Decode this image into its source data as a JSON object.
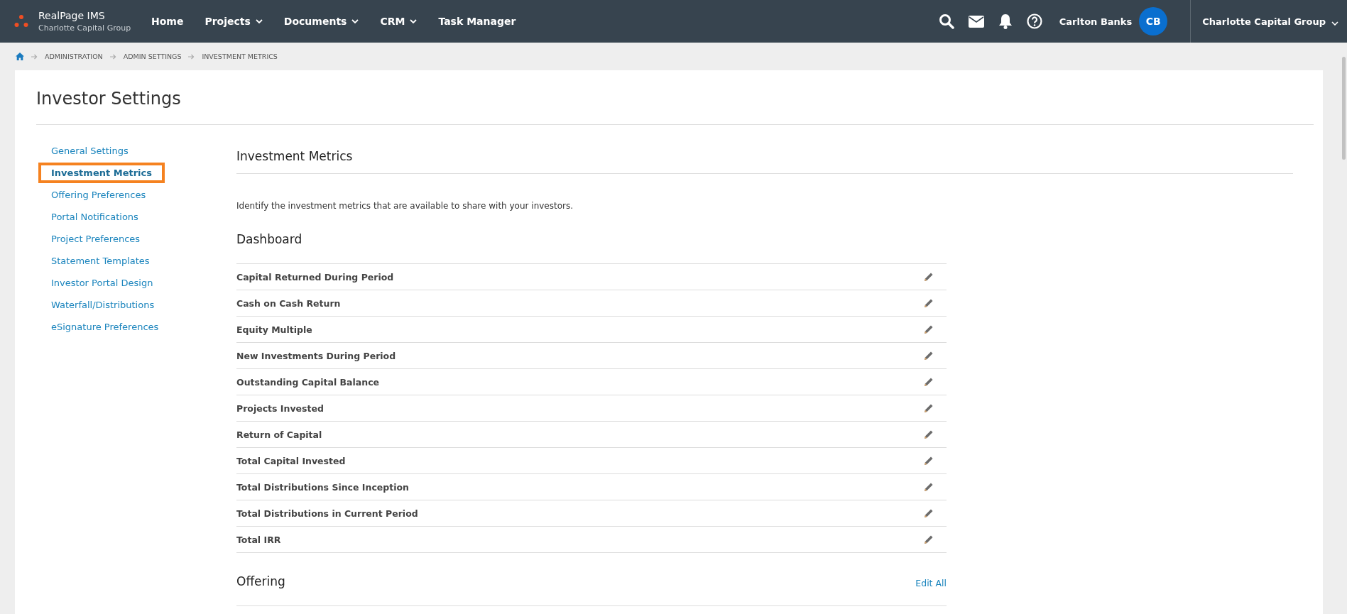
{
  "brand": {
    "name": "RealPage IMS",
    "subtitle": "Charlotte Capital Group"
  },
  "nav": [
    {
      "label": "Home",
      "dropdown": false
    },
    {
      "label": "Projects",
      "dropdown": true
    },
    {
      "label": "Documents",
      "dropdown": true
    },
    {
      "label": "CRM",
      "dropdown": true
    },
    {
      "label": "Task Manager",
      "dropdown": false
    }
  ],
  "user": {
    "name": "Carlton Banks",
    "initials": "CB"
  },
  "company": {
    "label": "Charlotte Capital Group"
  },
  "breadcrumb": [
    "ADMINISTRATION",
    "ADMIN SETTINGS",
    "INVESTMENT METRICS"
  ],
  "page_title": "Investor Settings",
  "sidebar": {
    "items": [
      {
        "label": "General Settings",
        "selected": false
      },
      {
        "label": "Investment Metrics",
        "selected": true
      },
      {
        "label": "Offering Preferences",
        "selected": false
      },
      {
        "label": "Portal Notifications",
        "selected": false
      },
      {
        "label": "Project Preferences",
        "selected": false
      },
      {
        "label": "Statement Templates",
        "selected": false
      },
      {
        "label": "Investor Portal Design",
        "selected": false
      },
      {
        "label": "Waterfall/Distributions",
        "selected": false
      },
      {
        "label": "eSignature Preferences",
        "selected": false
      }
    ]
  },
  "section_title": "Investment Metrics",
  "description": "Identify the investment metrics that are available to share with your investors.",
  "groups": [
    {
      "title": "Dashboard",
      "rows": [
        "Capital Returned During Period",
        "Cash on Cash Return",
        "Equity Multiple",
        "New Investments During Period",
        "Outstanding Capital Balance",
        "Projects Invested",
        "Return of Capital",
        "Total Capital Invested",
        "Total Distributions Since Inception",
        "Total Distributions in Current Period",
        "Total IRR"
      ]
    },
    {
      "title": "Offering",
      "action": "Edit All"
    }
  ]
}
